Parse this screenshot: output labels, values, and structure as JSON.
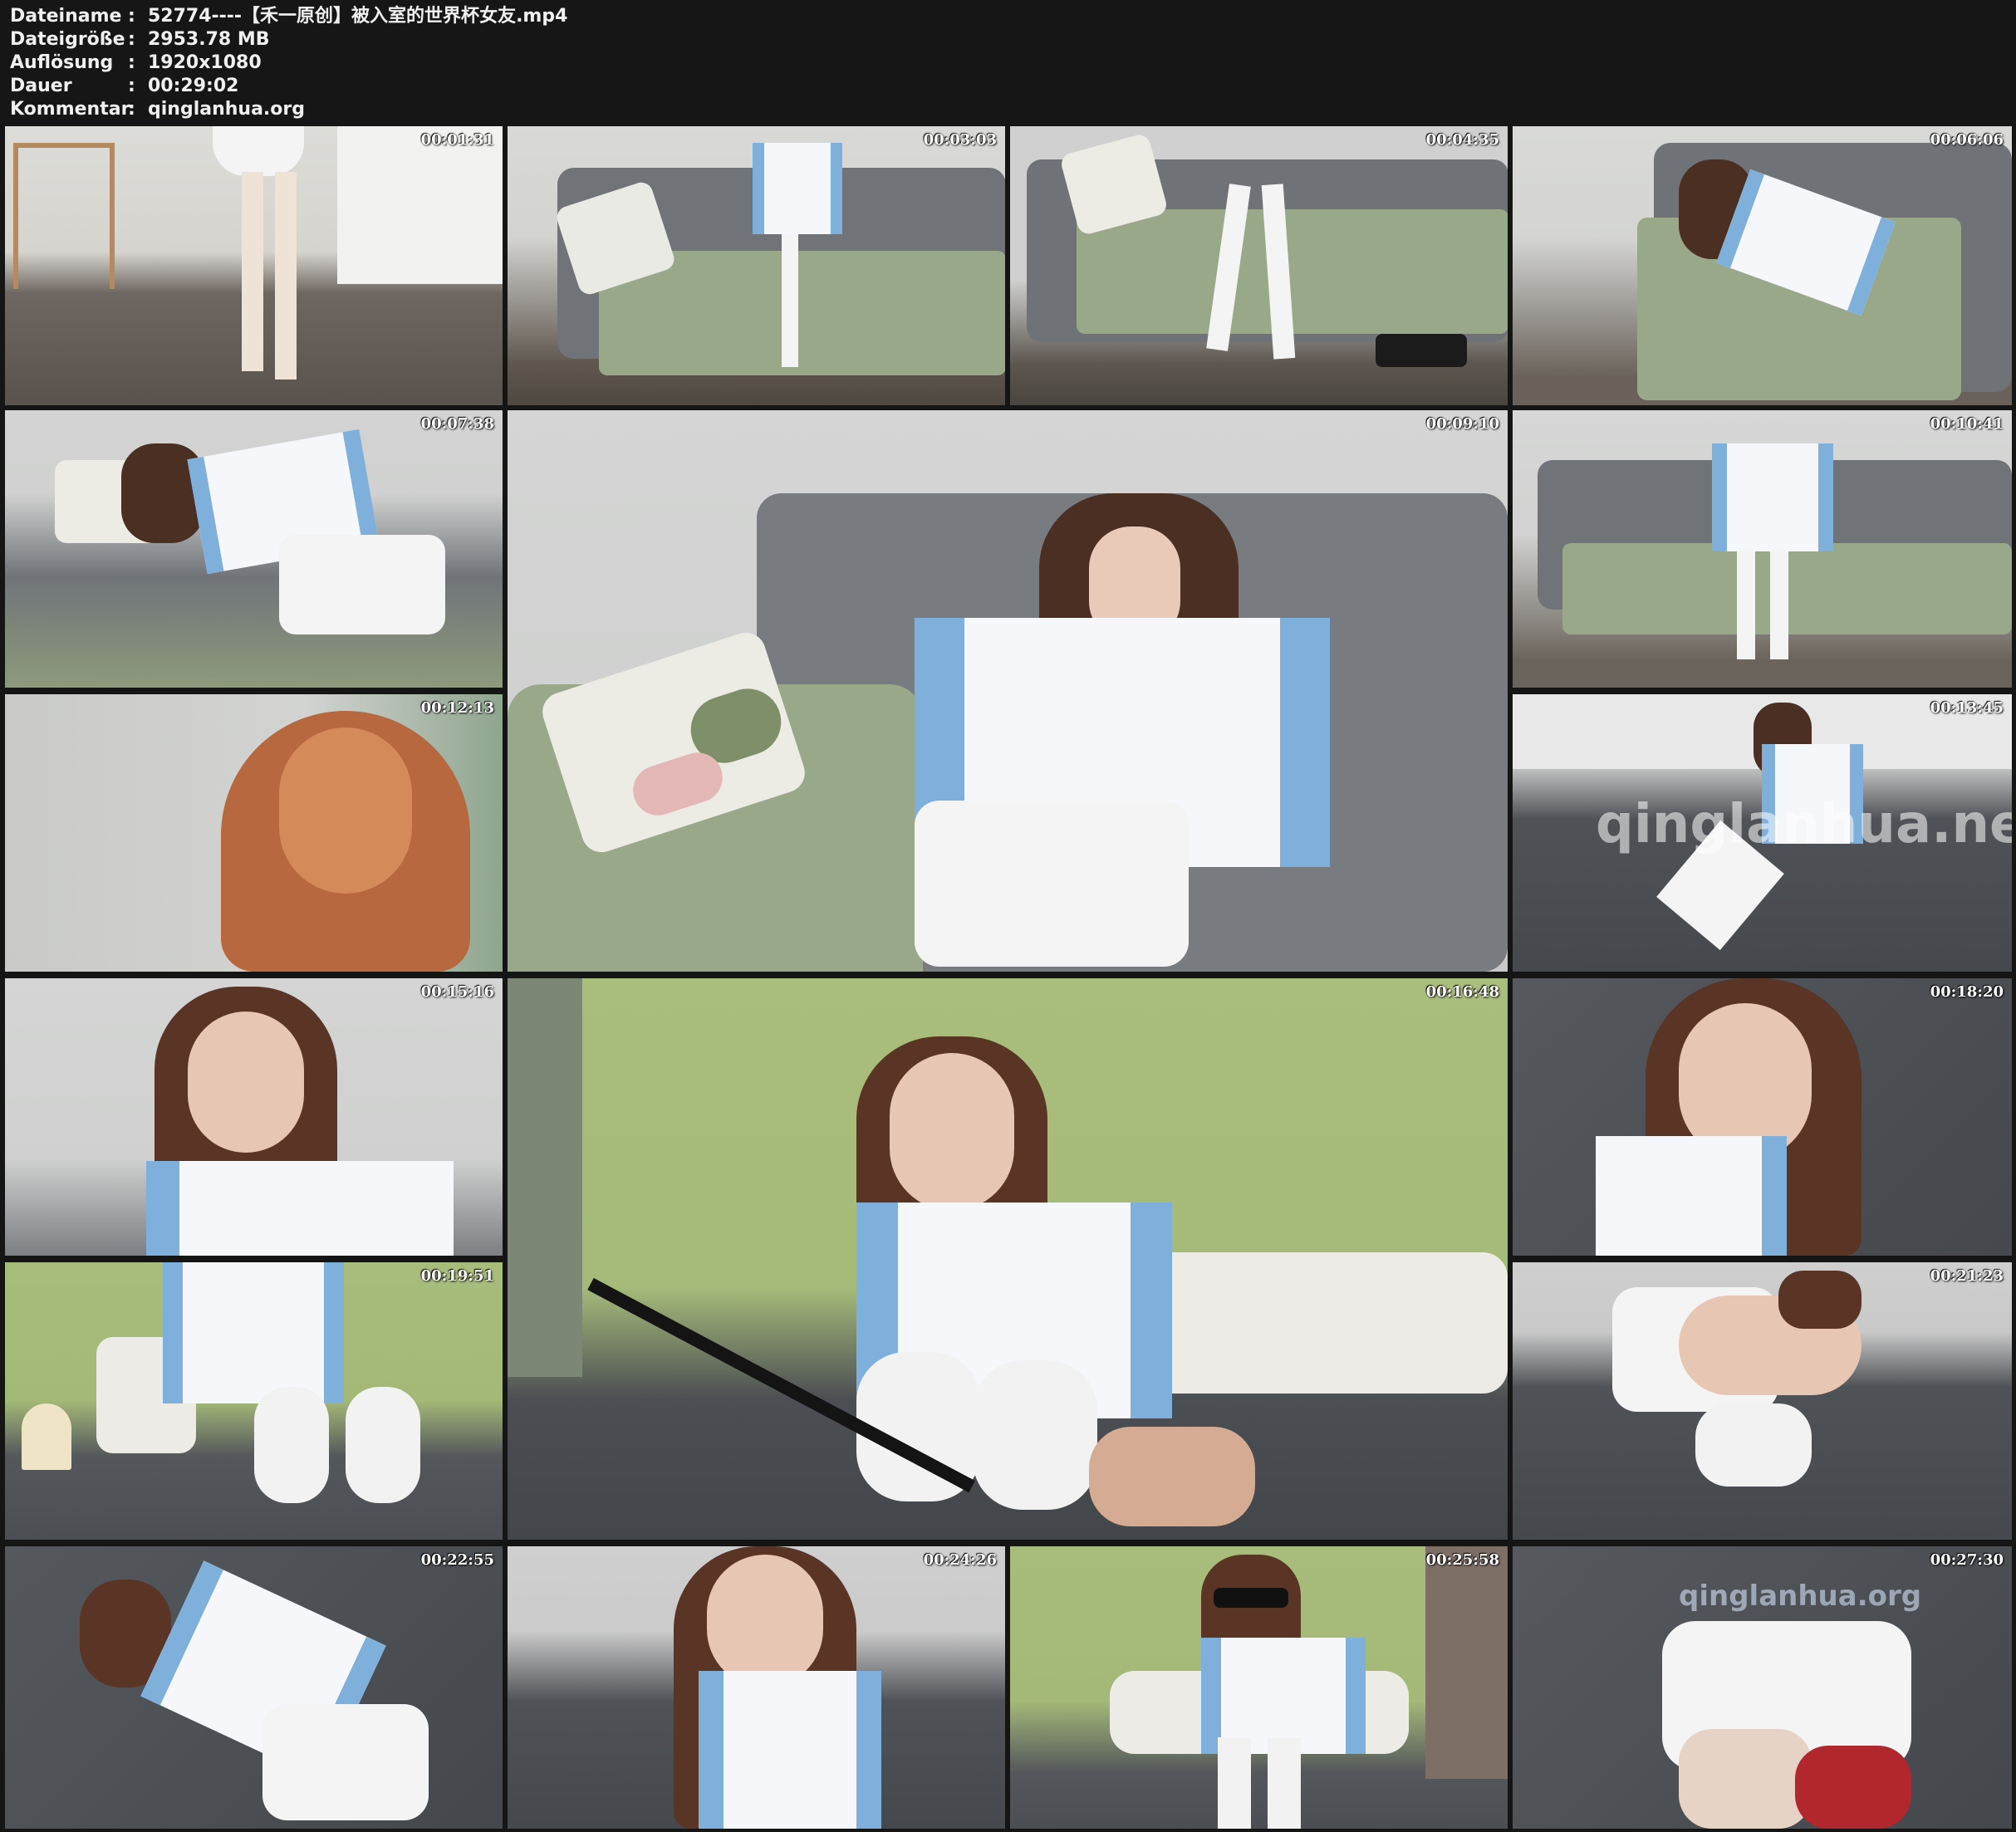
{
  "file_info": {
    "rows": [
      {
        "label": "Dateiname",
        "sep": ":",
        "value": "52774----【禾一原创】被入室的世界杯女友.mp4"
      },
      {
        "label": "Dateigröße",
        "sep": ":",
        "value": "2953.78 MB"
      },
      {
        "label": "Auflösung",
        "sep": ":",
        "value": "1920x1080"
      },
      {
        "label": "Dauer",
        "sep": ":",
        "value": "00:29:02"
      },
      {
        "label": "Kommentar",
        "sep": ":",
        "value": "qinglanhua.org"
      }
    ]
  },
  "thumbnails": [
    {
      "timestamp": "00:01:31",
      "scene": "room-floor-legs"
    },
    {
      "timestamp": "00:03:03",
      "scene": "sofa-sitting-phone"
    },
    {
      "timestamp": "00:04:35",
      "scene": "sofa-legs-closeup"
    },
    {
      "timestamp": "00:06:06",
      "scene": "sofa-lying"
    },
    {
      "timestamp": "00:07:38",
      "scene": "sofa-lying-close"
    },
    {
      "timestamp": "00:09:10",
      "scene": "sofa-large"
    },
    {
      "timestamp": "00:10:41",
      "scene": "sofa-sitting-wide"
    },
    {
      "timestamp": "00:12:13",
      "scene": "hair-closeup"
    },
    {
      "timestamp": "00:13:45",
      "scene": "bed-sitting"
    },
    {
      "timestamp": "00:15:16",
      "scene": "face-closeup"
    },
    {
      "timestamp": "00:16:48",
      "scene": "bedroom-large"
    },
    {
      "timestamp": "00:18:20",
      "scene": "face-closeup-bed"
    },
    {
      "timestamp": "00:19:51",
      "scene": "bed-feet"
    },
    {
      "timestamp": "00:21:23",
      "scene": "bed-lying-skirt"
    },
    {
      "timestamp": "00:22:55",
      "scene": "bed-lying-jersey"
    },
    {
      "timestamp": "00:24:26",
      "scene": "bed-portrait"
    },
    {
      "timestamp": "00:25:58",
      "scene": "bedroom-blindfold"
    },
    {
      "timestamp": "00:27:30",
      "scene": "bed-lying-back"
    }
  ],
  "watermarks": {
    "large": "qinglanhua.net",
    "corner": "qinglanhua.org"
  },
  "colors": {
    "background": "#151515",
    "text": "#f0f0f0",
    "jersey_blue": "#7fb0dc",
    "sofa_grey": "#7a7d80",
    "throw_green": "#9aa88a",
    "wall_green": "#a8bc7c"
  }
}
